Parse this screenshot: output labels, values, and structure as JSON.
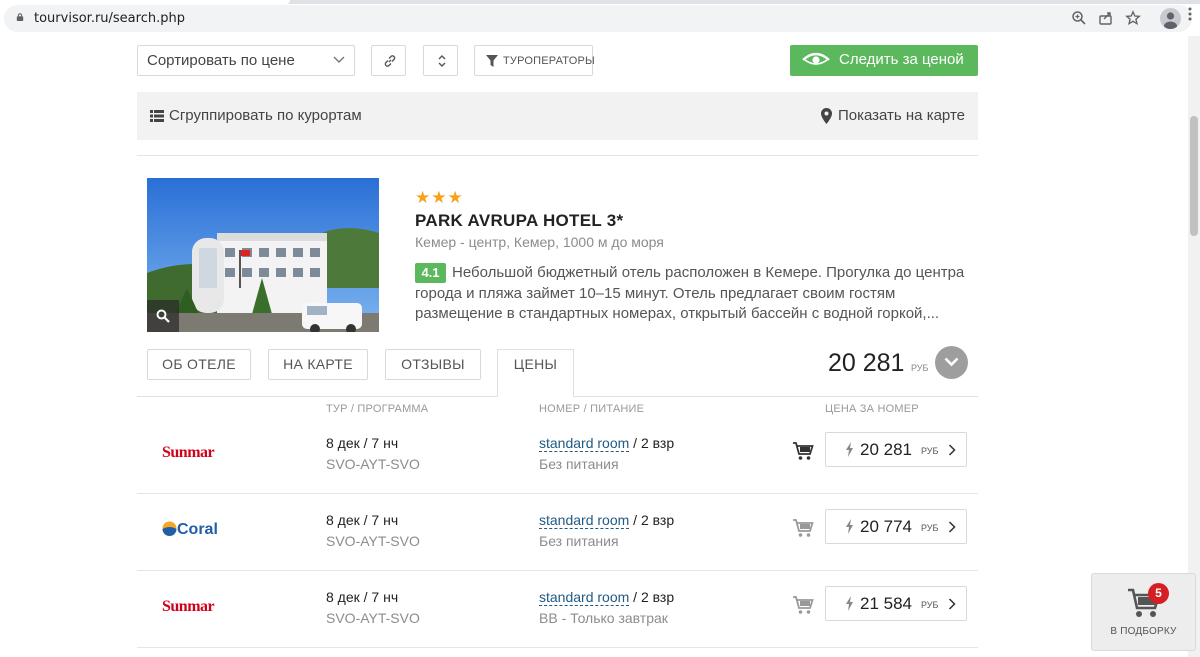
{
  "browser": {
    "url": "tourvisor.ru/search.php",
    "icons": [
      "lock-icon",
      "zoom-icon",
      "share-icon",
      "star-icon",
      "profile-icon",
      "menu-icon"
    ]
  },
  "toolbar": {
    "sort_label": "Сортировать по цене",
    "operators_label": "ТУРОПЕРАТОРЫ",
    "watch_label": "Следить за ценой",
    "group_label": "Сгруппировать по курортам",
    "map_label": "Показать на карте"
  },
  "hotel": {
    "stars": 3,
    "name": "PARK AVRUPA HOTEL 3*",
    "location": "Кемер - центр, Кемер, 1000 м до моря",
    "rating": "4.1",
    "description": "Небольшой бюджетный отель расположен в Кемере. Прогулка до центра города и пляжа займет 10–15 минут. Отель предлагает своим гостям размещение в стандартных номерах, открытый бассейн с водной горкой,..."
  },
  "tabs": {
    "about": "ОБ ОТЕЛЕ",
    "map": "НА КАРТЕ",
    "reviews": "ОТЗЫВЫ",
    "prices": "ЦЕНЫ",
    "active": "prices"
  },
  "summary": {
    "price": "20 281",
    "currency": "РУБ"
  },
  "table": {
    "headers": {
      "tour": "ТУР / ПРОГРАММА",
      "room": "НОМЕР / ПИТАНИЕ",
      "price": "ЦЕНА ЗА НОМЕР"
    },
    "rows": [
      {
        "operator": "Sunmar",
        "date": "8 дек / 7 нч",
        "route": "SVO-AYT-SVO",
        "room": "standard room",
        "guests": " / 2 взр",
        "meal": "Без питания",
        "price": "20 281",
        "currency": "РУБ"
      },
      {
        "operator": "Coral",
        "date": "8 дек / 7 нч",
        "route": "SVO-AYT-SVO",
        "room": "standard room",
        "guests": " / 2 взр",
        "meal": "Без питания",
        "price": "20 774",
        "currency": "РУБ"
      },
      {
        "operator": "Sunmar",
        "date": "8 дек / 7 нч",
        "route": "SVO-AYT-SVO",
        "room": "standard room",
        "guests": " / 2 взр",
        "meal": "BB - Только завтрак",
        "price": "21 584",
        "currency": "РУБ"
      }
    ]
  },
  "collection": {
    "count": "5",
    "label": "В ПОДБОРКУ"
  },
  "colors": {
    "accent_green": "#5cb85c",
    "star_orange": "#f7a21b",
    "link_blue": "#1f5a85",
    "sunmar_red": "#d0021b",
    "coral_blue": "#1f5fa8",
    "badge_red": "#d42023"
  }
}
